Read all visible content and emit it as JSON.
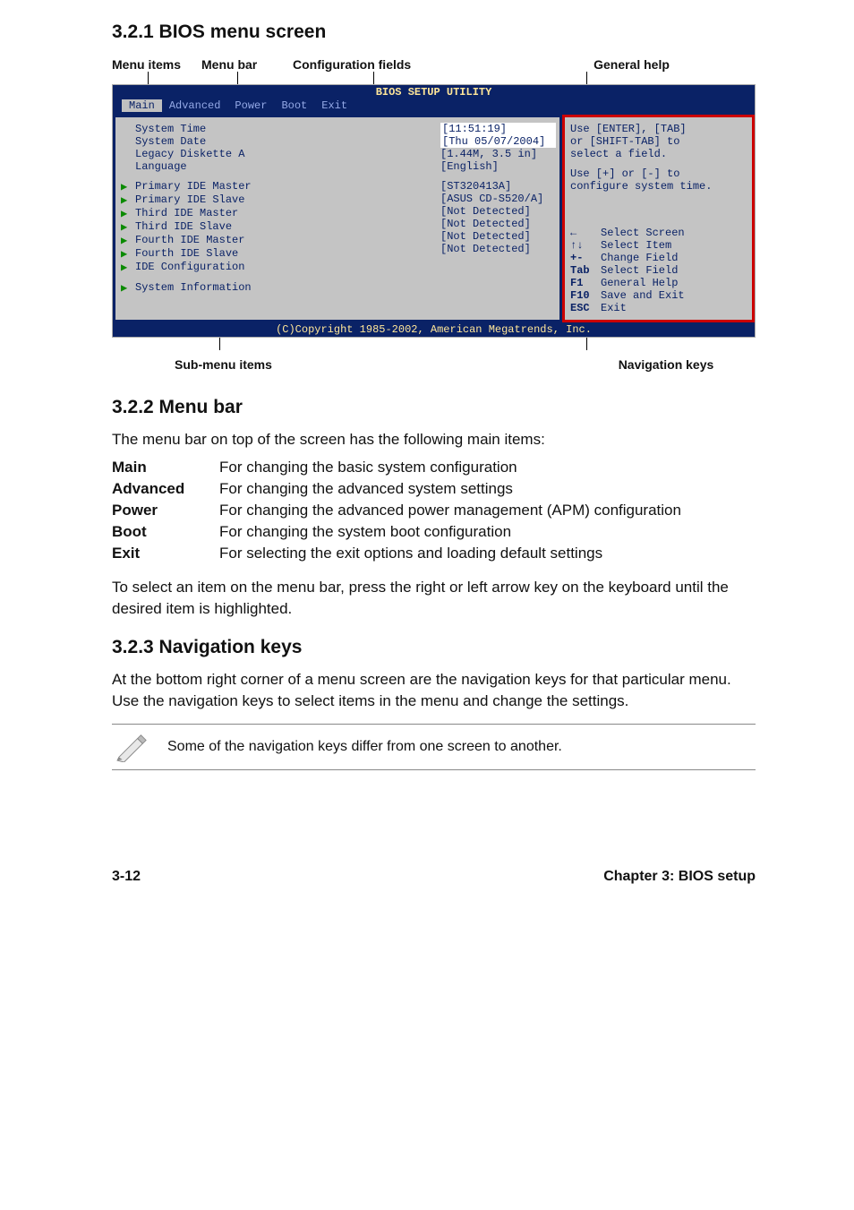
{
  "sections": {
    "s1": "3.2.1   BIOS menu screen",
    "s2": "3.2.2   Menu bar",
    "s3": "3.2.3   Navigation keys"
  },
  "topLabels": {
    "menuItems": "Menu items",
    "menuBar": "Menu bar",
    "configFields": "Configuration fields",
    "generalHelp": "General help"
  },
  "bios": {
    "title": "BIOS SETUP UTILITY",
    "tabs": {
      "main": "Main",
      "advanced": "Advanced",
      "power": "Power",
      "boot": "Boot",
      "exit": "Exit"
    },
    "left": {
      "l1": "System Time",
      "l2": "System Date",
      "l3": "Legacy Diskette A",
      "l4": "Language",
      "l5": "Primary IDE Master",
      "l6": "Primary IDE Slave",
      "l7": "Third IDE Master",
      "l8": "Third IDE Slave",
      "l9": "Fourth IDE Master",
      "l10": "Fourth IDE Slave",
      "l11": "IDE Configuration",
      "l12": "System Information"
    },
    "mid": {
      "v1": "[11:51:19]",
      "v2": "[Thu 05/07/2004]",
      "v3": "[1.44M, 3.5 in]",
      "v4": "[English]",
      "v5": "[ST320413A]",
      "v6": "[ASUS CD-S520/A]",
      "v7": "[Not Detected]",
      "v8": "[Not Detected]",
      "v9": "[Not Detected]",
      "v10": "[Not Detected]"
    },
    "right": {
      "h1": "Use [ENTER], [TAB]",
      "h2": "or [SHIFT-TAB] to",
      "h3": "select a field.",
      "h4": "Use [+] or [-] to",
      "h5": "configure system time.",
      "nav": [
        {
          "k": "←",
          "t": "Select Screen"
        },
        {
          "k": "↑↓",
          "t": "Select Item"
        },
        {
          "k": "+-",
          "t": "Change Field"
        },
        {
          "k": "Tab",
          "t": "Select Field"
        },
        {
          "k": "F1",
          "t": "General Help"
        },
        {
          "k": "F10",
          "t": "Save and Exit"
        },
        {
          "k": "ESC",
          "t": "Exit"
        }
      ]
    },
    "footer": "(C)Copyright 1985-2002, American Megatrends, Inc."
  },
  "underLabels": {
    "sub": "Sub-menu items",
    "nav": "Navigation keys"
  },
  "menubarIntro": "The menu bar on top of the screen has the following main items:",
  "menuDesc": {
    "main": {
      "k": "Main",
      "v": "For changing the basic system configuration"
    },
    "adv": {
      "k": "Advanced",
      "v": "For changing the advanced system settings"
    },
    "pow": {
      "k": "Power",
      "v": "For changing the advanced power management (APM) configuration"
    },
    "boot": {
      "k": "Boot",
      "v": "For changing the system boot configuration"
    },
    "exit": {
      "k": "Exit",
      "v": "For selecting the exit options and loading default settings"
    }
  },
  "menubarOutro": "To select an item on the menu bar, press the right or left arrow key on the keyboard until the desired item is highlighted.",
  "navText": "At the bottom right corner of a menu screen are the navigation keys for that particular menu. Use the navigation keys to select items in the menu and change the settings.",
  "noteText": "Some of the navigation keys differ from one screen to another.",
  "footer": {
    "left": "3-12",
    "right": "Chapter 3: BIOS setup"
  }
}
